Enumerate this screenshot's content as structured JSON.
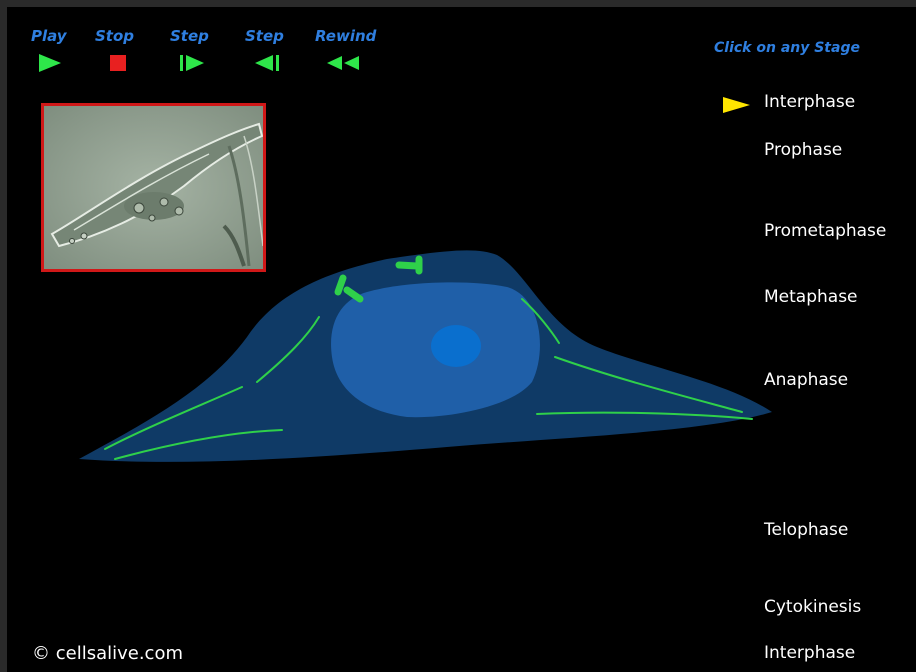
{
  "controls": [
    {
      "id": "play",
      "label": "Play",
      "icon": "play-icon"
    },
    {
      "id": "stop",
      "label": "Stop",
      "icon": "stop-icon"
    },
    {
      "id": "step-forward",
      "label": "Step",
      "icon": "step-forward-icon"
    },
    {
      "id": "step-back",
      "label": "Step",
      "icon": "step-back-icon"
    },
    {
      "id": "rewind",
      "label": "Rewind",
      "icon": "rewind-icon"
    }
  ],
  "stage_menu": {
    "hint": "Click on any Stage",
    "stages": [
      "Interphase",
      "Prophase",
      "Prometaphase",
      "Metaphase",
      "Anaphase",
      "Telophase",
      "Cytokinesis",
      "Interphase"
    ],
    "selected": "Interphase"
  },
  "copyright": "© cellsalive.com",
  "colors": {
    "control_label": "#2f7fe0",
    "control_icon": "#2ee64a",
    "stop_icon": "#e82020",
    "stage_text": "#ffffff",
    "pointer": "#ffe600",
    "cytoplasm": "#0f3a66",
    "nucleus": "#1f5fa8",
    "nucleolus": "#0a6fce",
    "microtubules": "#2fd04a",
    "photo_border": "#d01818"
  }
}
